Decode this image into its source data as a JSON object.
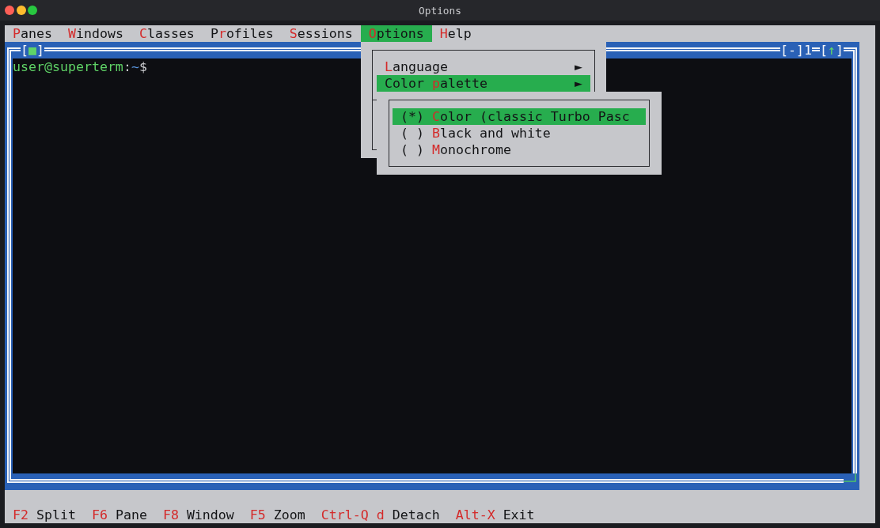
{
  "window": {
    "title": "Options"
  },
  "menu_bar": [
    {
      "label": [
        {
          "text": "P",
          "hotkey": true
        },
        {
          "text": "anes",
          "hotkey": false
        }
      ],
      "selected": false
    },
    {
      "label": [
        {
          "text": "W",
          "hotkey": true
        },
        {
          "text": "indows",
          "hotkey": false
        }
      ],
      "selected": false
    },
    {
      "label": [
        {
          "text": "C",
          "hotkey": true
        },
        {
          "text": "lasses",
          "hotkey": false
        }
      ],
      "selected": false
    },
    {
      "label": [
        {
          "text": "P",
          "hotkey": false
        },
        {
          "text": "r",
          "hotkey": true
        },
        {
          "text": "ofiles",
          "hotkey": false
        }
      ],
      "selected": false
    },
    {
      "label": [
        {
          "text": "S",
          "hotkey": true
        },
        {
          "text": "essions",
          "hotkey": false
        }
      ],
      "selected": false
    },
    {
      "label": [
        {
          "text": "O",
          "hotkey": true
        },
        {
          "text": "ptions",
          "hotkey": false
        }
      ],
      "selected": true
    },
    {
      "label": [
        {
          "text": "H",
          "hotkey": true
        },
        {
          "text": "elp",
          "hotkey": false
        }
      ],
      "selected": false
    }
  ],
  "options_menu": {
    "items": [
      {
        "label": [
          {
            "text": "L",
            "hotkey": true
          },
          {
            "text": "anguage",
            "hotkey": false
          }
        ],
        "arrow": "►",
        "selected": false
      },
      {
        "label": [
          {
            "text": "Color ",
            "hotkey": false
          },
          {
            "text": "p",
            "hotkey": true
          },
          {
            "text": "alette",
            "hotkey": false
          }
        ],
        "arrow": "►",
        "selected": true
      }
    ]
  },
  "color_palette_menu": {
    "items": [
      {
        "mark": "(*)",
        "label": [
          {
            "text": "C",
            "hotkey": true
          },
          {
            "text": "olor (classic Turbo Pasc",
            "hotkey": false
          }
        ],
        "selected": true
      },
      {
        "mark": "( )",
        "label": [
          {
            "text": "B",
            "hotkey": true
          },
          {
            "text": "lack and white",
            "hotkey": false
          }
        ],
        "selected": false
      },
      {
        "mark": "( )",
        "label": [
          {
            "text": "M",
            "hotkey": true
          },
          {
            "text": "onochrome",
            "hotkey": false
          }
        ],
        "selected": false
      }
    ]
  },
  "terminal_window": {
    "close_button": {
      "left": "[",
      "symbol": "■",
      "right": "]"
    },
    "minimize_button": "[-]",
    "number": "1",
    "zoom_button": {
      "left": "[",
      "symbol": "↑",
      "right": "]"
    },
    "prompt": {
      "user_host": "user@superterm",
      "separator": ":",
      "path": "~",
      "symbol": "$"
    }
  },
  "status_bar": [
    {
      "key": "F2",
      "label": "Split"
    },
    {
      "key": "F6",
      "label": "Pane"
    },
    {
      "key": "F8",
      "label": "Window"
    },
    {
      "key": "F5",
      "label": "Zoom"
    },
    {
      "key": "Ctrl-Q d",
      "label": "Detach"
    },
    {
      "key": "Alt-X",
      "label": "Exit"
    }
  ]
}
